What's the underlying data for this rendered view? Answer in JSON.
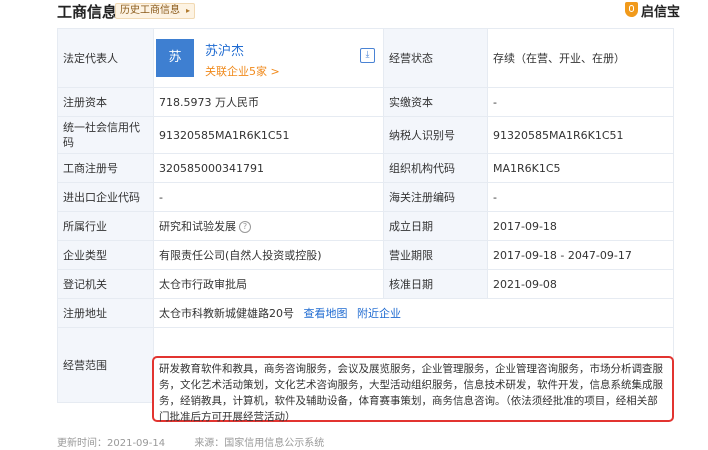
{
  "header": {
    "title": "工商信息",
    "history_badge": "历史工商信息",
    "logo_text": "启信宝"
  },
  "legal": {
    "label": "法定代表人",
    "avatar_text": "苏",
    "name": "苏沪杰",
    "related": "关联企业5家 >",
    "status_label": "经营状态",
    "status_value": "存续（在营、开业、在册）"
  },
  "rows": [
    {
      "l1": "注册资本",
      "v1": "718.5973 万人民币",
      "l2": "实缴资本",
      "v2": "-"
    },
    {
      "l1": "统一社会信用代码",
      "v1": "91320585MA1R6K1C51",
      "l2": "纳税人识别号",
      "v2": "91320585MA1R6K1C51"
    },
    {
      "l1": "工商注册号",
      "v1": "320585000341791",
      "l2": "组织机构代码",
      "v2": "MA1R6K1C5"
    },
    {
      "l1": "进出口企业代码",
      "v1": "-",
      "l2": "海关注册编码",
      "v2": "-"
    },
    {
      "l1": "所属行业",
      "v1": "研究和试验发展",
      "l2": "成立日期",
      "v2": "2017-09-18"
    },
    {
      "l1": "企业类型",
      "v1": "有限责任公司(自然人投资或控股)",
      "l2": "营业期限",
      "v2": "2017-09-18 - 2047-09-17"
    },
    {
      "l1": "登记机关",
      "v1": "太仓市行政审批局",
      "l2": "核准日期",
      "v2": "2021-09-08"
    }
  ],
  "address": {
    "label": "注册地址",
    "value": "太仓市科教新城健雄路20号",
    "map_link": "查看地图",
    "nearby_link": "附近企业"
  },
  "scope": {
    "label": "经营范围",
    "value": "研发教育软件和教具，商务咨询服务，会议及展览服务，企业管理服务，企业管理咨询服务，市场分析调查服务，文化艺术活动策划，文化艺术咨询服务，大型活动组织服务，信息技术研发，软件开发，信息系统集成服务，经销教具，计算机，软件及辅助设备，体育赛事策划，商务信息咨询。（依法须经批准的项目，经相关部门批准后方可开展经营活动）"
  },
  "footer": {
    "updated": "更新时间：2021-09-14",
    "source": "来源：国家信用信息公示系统"
  },
  "colors": {
    "accent": "#1f6bd1",
    "orange": "#f08a1c",
    "highlight": "#e23430"
  }
}
